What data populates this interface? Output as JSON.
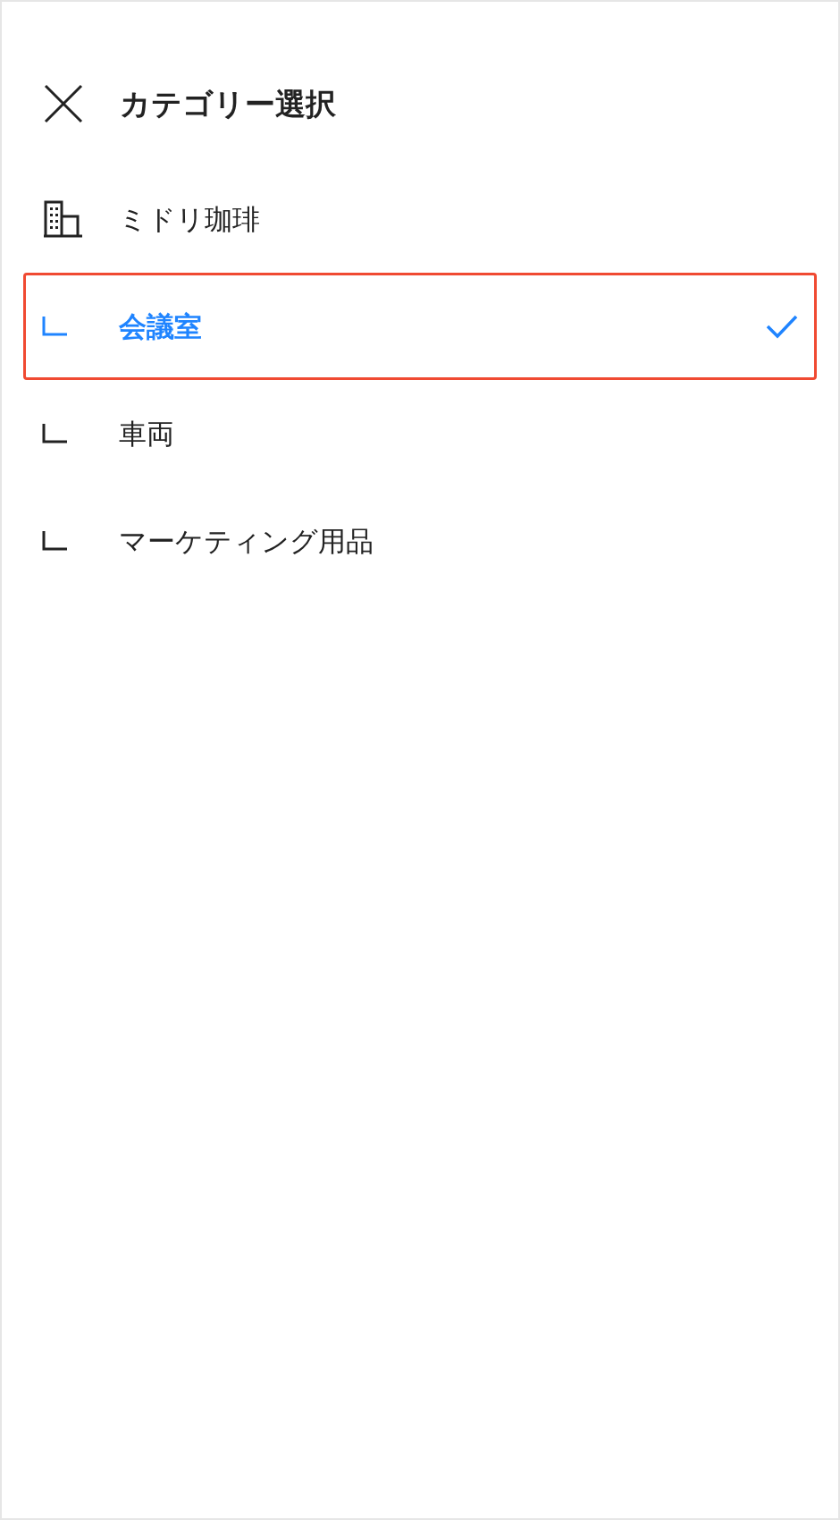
{
  "header": {
    "title": "カテゴリー選択"
  },
  "categories": [
    {
      "name": "ミドリ珈琲",
      "selected": false,
      "highlighted": false,
      "children": [
        {
          "name": "会議室",
          "selected": true,
          "highlighted": true
        },
        {
          "name": "車両",
          "selected": false,
          "highlighted": false
        },
        {
          "name": "マーケティング用品",
          "selected": false,
          "highlighted": false
        }
      ]
    }
  ]
}
